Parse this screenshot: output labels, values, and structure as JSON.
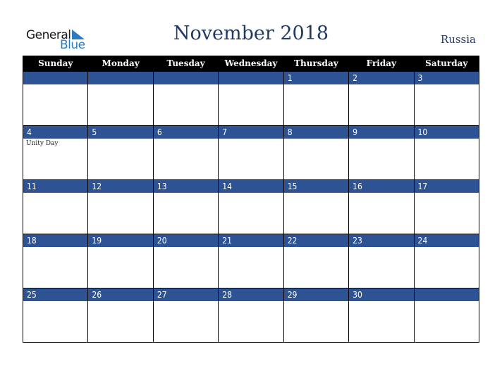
{
  "logo": {
    "line1": "General",
    "line2": "Blue"
  },
  "title": "November 2018",
  "country": "Russia",
  "colors": {
    "header_bg": "#000000",
    "day_bar": "#2e5395",
    "title": "#223a63",
    "logo_blue": "#2a7bc4"
  },
  "weekdays": [
    "Sunday",
    "Monday",
    "Tuesday",
    "Wednesday",
    "Thursday",
    "Friday",
    "Saturday"
  ],
  "weeks": [
    [
      {
        "day": ""
      },
      {
        "day": ""
      },
      {
        "day": ""
      },
      {
        "day": ""
      },
      {
        "day": "1"
      },
      {
        "day": "2"
      },
      {
        "day": "3"
      }
    ],
    [
      {
        "day": "4",
        "event": "Unity Day"
      },
      {
        "day": "5"
      },
      {
        "day": "6"
      },
      {
        "day": "7"
      },
      {
        "day": "8"
      },
      {
        "day": "9"
      },
      {
        "day": "10"
      }
    ],
    [
      {
        "day": "11"
      },
      {
        "day": "12"
      },
      {
        "day": "13"
      },
      {
        "day": "14"
      },
      {
        "day": "15"
      },
      {
        "day": "16"
      },
      {
        "day": "17"
      }
    ],
    [
      {
        "day": "18"
      },
      {
        "day": "19"
      },
      {
        "day": "20"
      },
      {
        "day": "21"
      },
      {
        "day": "22"
      },
      {
        "day": "23"
      },
      {
        "day": "24"
      }
    ],
    [
      {
        "day": "25"
      },
      {
        "day": "26"
      },
      {
        "day": "27"
      },
      {
        "day": "28"
      },
      {
        "day": "29"
      },
      {
        "day": "30"
      },
      {
        "day": ""
      }
    ]
  ]
}
